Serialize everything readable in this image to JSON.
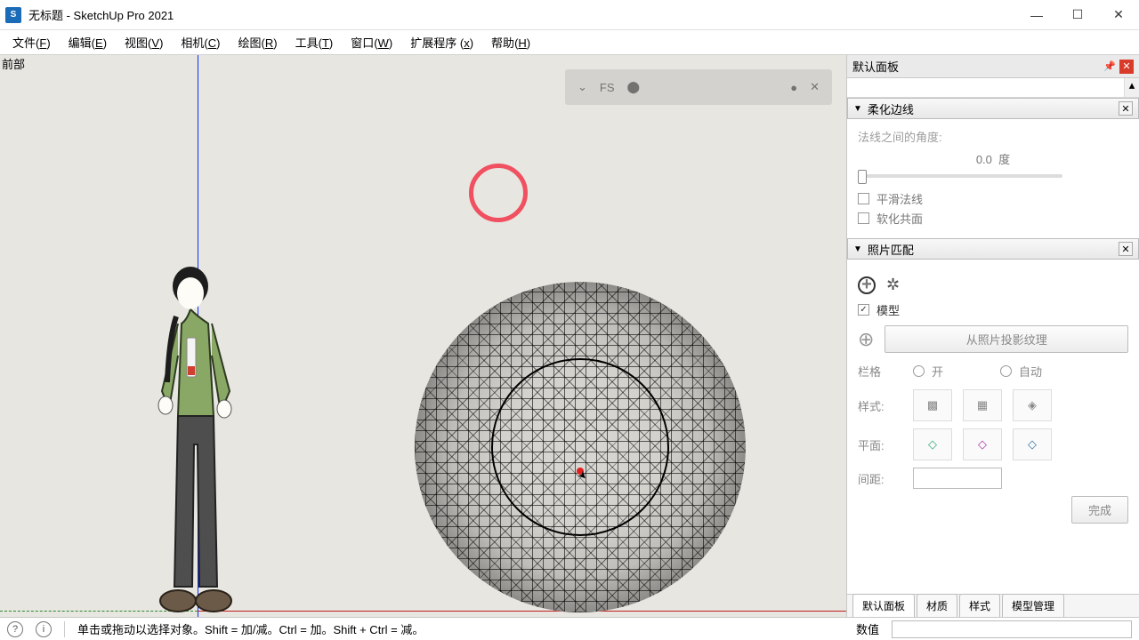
{
  "window": {
    "title": "无标题 - SketchUp Pro 2021",
    "controls": {
      "min": "—",
      "max": "☐",
      "close": "✕"
    }
  },
  "menubar": [
    {
      "label": "文件",
      "key": "F"
    },
    {
      "label": "编辑",
      "key": "E"
    },
    {
      "label": "视图",
      "key": "V"
    },
    {
      "label": "相机",
      "key": "C"
    },
    {
      "label": "绘图",
      "key": "R"
    },
    {
      "label": "工具",
      "key": "T"
    },
    {
      "label": "窗口",
      "key": "W"
    },
    {
      "label": "扩展程序",
      "key": "x"
    },
    {
      "label": "帮助",
      "key": "H"
    }
  ],
  "viewport": {
    "label": "前部"
  },
  "overlay": {
    "fs": "FS"
  },
  "side_panel": {
    "title": "默认面板",
    "soften": {
      "header": "柔化边线",
      "angle_label": "法线之间的角度:",
      "angle_value": "0.0",
      "angle_unit": "度",
      "smooth": "平滑法线",
      "coplanar": "软化共面"
    },
    "photo": {
      "header": "照片匹配",
      "model": "模型",
      "project_btn": "从照片投影纹理",
      "grid_label": "栏格",
      "grid_on": "开",
      "grid_auto": "自动",
      "style_label": "样式:",
      "plane_label": "平面:",
      "spacing_label": "间距:",
      "done": "完成"
    },
    "tabs": [
      "默认面板",
      "材质",
      "样式",
      "模型管理"
    ]
  },
  "status": {
    "hint": "单击或拖动以选择对象。Shift = 加/减。Ctrl = 加。Shift + Ctrl = 减。",
    "value_label": "数值"
  }
}
